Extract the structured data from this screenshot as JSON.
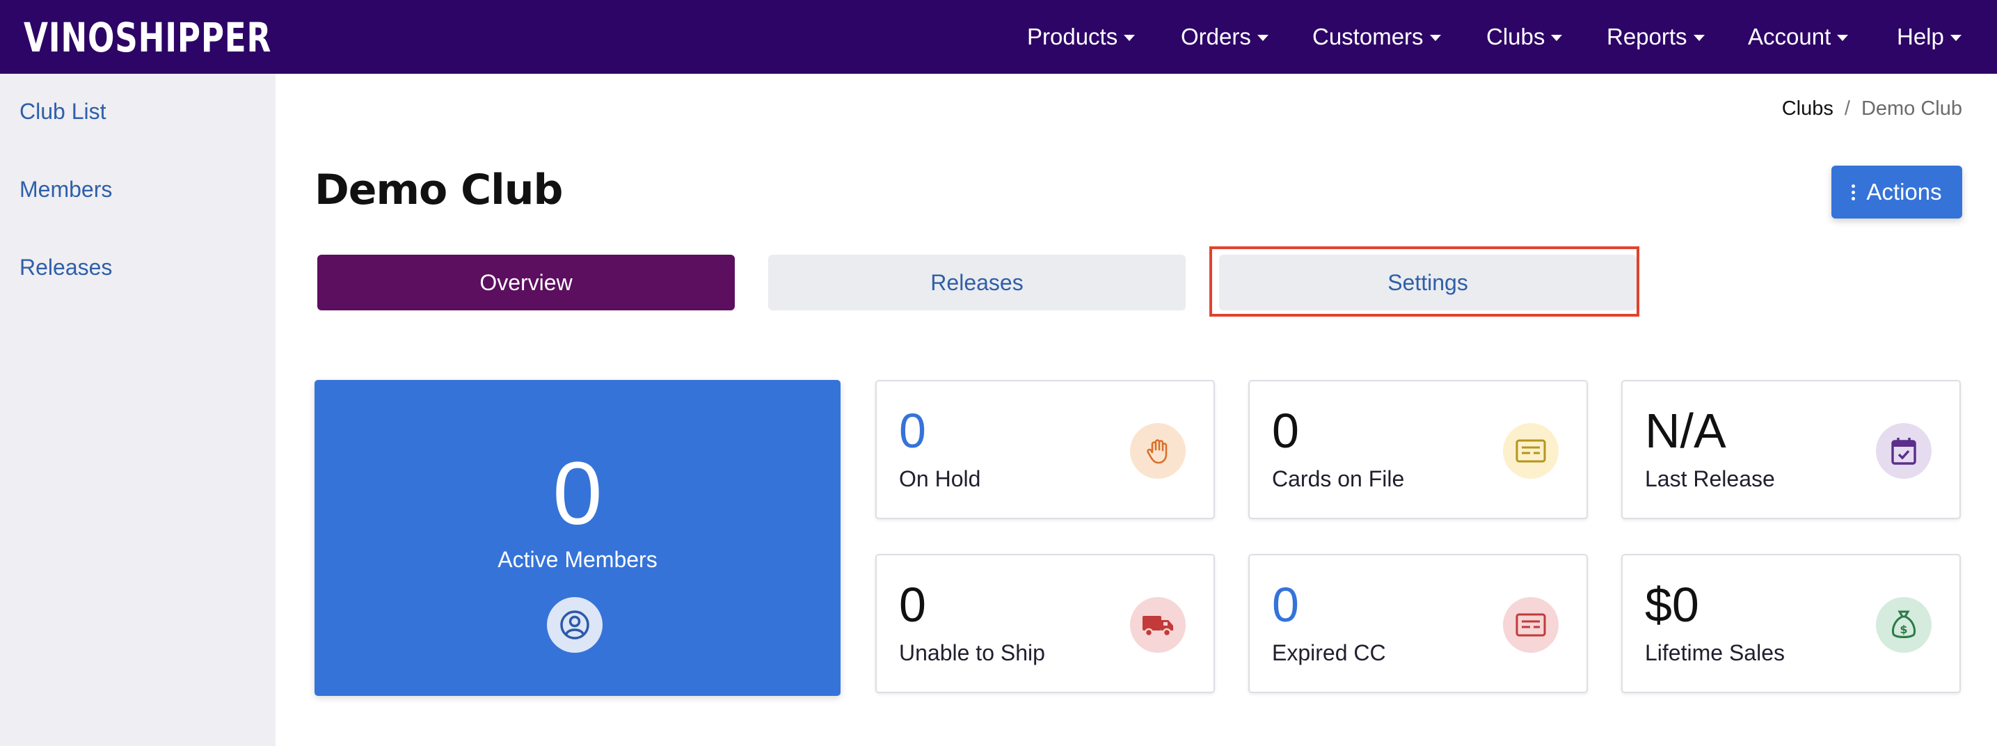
{
  "brand": {
    "logo_text": "VINOSHIPPER"
  },
  "nav": {
    "items": [
      {
        "label": "Products"
      },
      {
        "label": "Orders"
      },
      {
        "label": "Customers"
      },
      {
        "label": "Clubs"
      },
      {
        "label": "Reports"
      },
      {
        "label": "Account"
      },
      {
        "label": "Help"
      }
    ]
  },
  "sidebar": {
    "items": [
      {
        "label": "Club List"
      },
      {
        "label": "Members"
      },
      {
        "label": "Releases"
      }
    ]
  },
  "breadcrumb": {
    "parent": "Clubs",
    "separator": "/",
    "current": "Demo Club"
  },
  "page": {
    "title": "Demo Club",
    "actions_label": "Actions"
  },
  "tabs": [
    {
      "label": "Overview",
      "active": true
    },
    {
      "label": "Releases",
      "active": false
    },
    {
      "label": "Settings",
      "active": false
    }
  ],
  "stats": {
    "active_members": {
      "value": "0",
      "label": "Active Members",
      "icon": "user-circle-icon"
    },
    "cards": [
      {
        "value": "0",
        "label": "On Hold",
        "icon": "hand-icon",
        "icon_color": "#d9702a",
        "icon_bg": "#fbe4cf"
      },
      {
        "value": "0",
        "label": "Cards on File",
        "icon": "credit-card-icon",
        "icon_color": "#b8941d",
        "icon_bg": "#fcf1cc"
      },
      {
        "value": "N/A",
        "label": "Last Release",
        "icon": "calendar-check-icon",
        "icon_color": "#5b2e8a",
        "icon_bg": "#e6dcef"
      },
      {
        "value": "0",
        "label": "Unable to Ship",
        "icon": "truck-icon",
        "icon_color": "#c23a3a",
        "icon_bg": "#f6d6d6"
      },
      {
        "value": "0",
        "label": "Expired CC",
        "icon": "credit-card-icon",
        "icon_color": "#c23a3a",
        "icon_bg": "#f6d6d6"
      },
      {
        "value": "$0",
        "label": "Lifetime Sales",
        "icon": "money-bag-icon",
        "icon_color": "#2c7a4a",
        "icon_bg": "#d5ebdd"
      }
    ]
  },
  "colors": {
    "nav_bg": "#2d0566",
    "accent": "#3573d9",
    "active_tab": "#5c0e5f",
    "highlight": "#e0432f"
  }
}
